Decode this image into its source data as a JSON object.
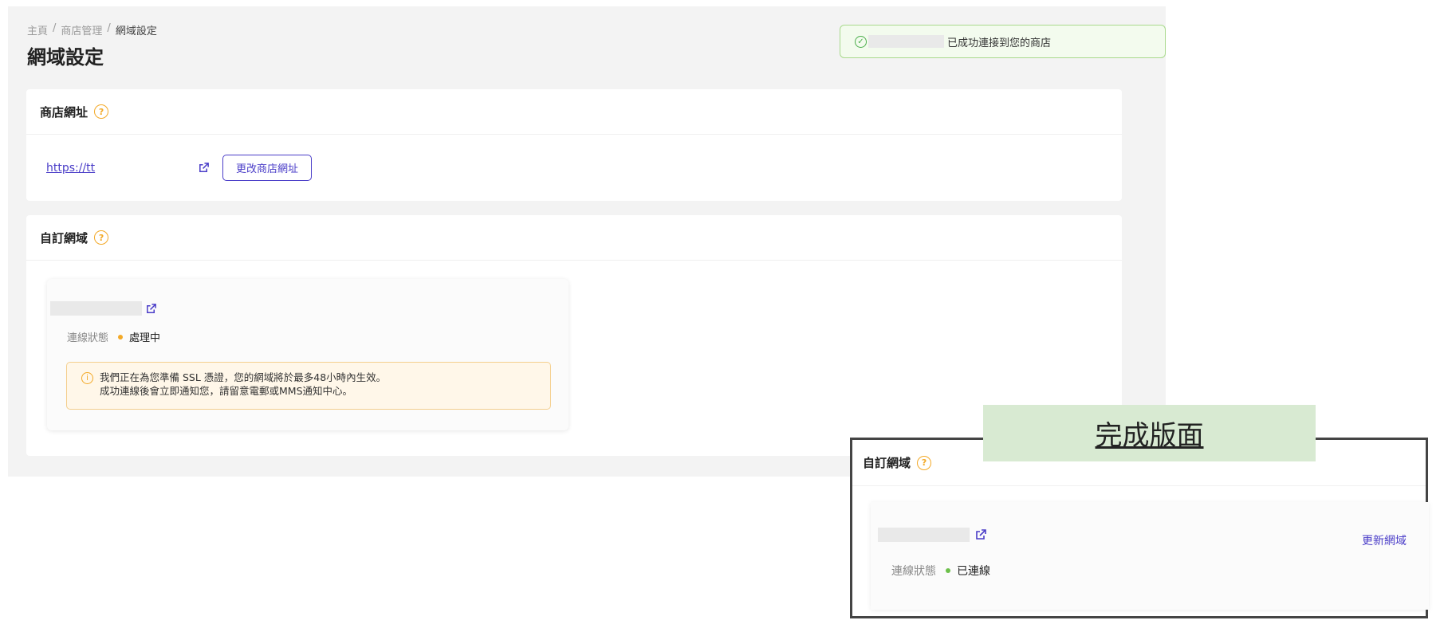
{
  "breadcrumb": {
    "home": "主頁",
    "sep": "/",
    "store": "商店管理",
    "current": "網域設定"
  },
  "page_title": "網域設定",
  "toast": {
    "message": "已成功連接到您的商店"
  },
  "store_url_card": {
    "title": "商店網址",
    "help": "?",
    "url": "https://tt",
    "change_button": "更改商店網址"
  },
  "custom_domain_card": {
    "title": "自訂網域",
    "help": "?",
    "status_label": "連線狀態",
    "status_value": "處理中",
    "status_color": "#f3a927",
    "notice_line1": "我們正在為您準備 SSL 憑證，您的網域將於最多48小時內生效。",
    "notice_line2": "成功連線後會立即通知您，請留意電郵或MMS通知中心。"
  },
  "completed_preview": {
    "banner": "完成版面",
    "title": "自訂網域",
    "help": "?",
    "update_link": "更新網域",
    "status_label": "連線狀態",
    "status_value": "已連線",
    "status_color": "#6cc04a"
  },
  "icons": {
    "check": "check-circle-icon",
    "help": "question-circle-icon",
    "external": "external-link-icon",
    "info": "info-circle-icon"
  }
}
